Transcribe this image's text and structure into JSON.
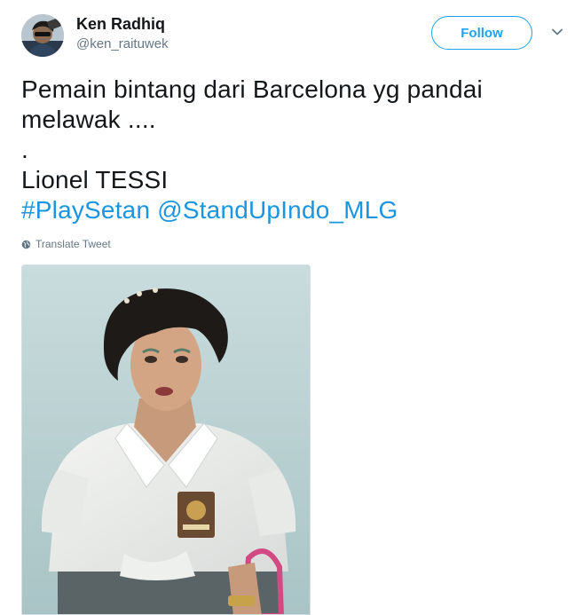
{
  "user": {
    "display_name": "Ken Radhiq",
    "handle": "@ken_raituwek"
  },
  "actions": {
    "follow_label": "Follow"
  },
  "tweet": {
    "line1": "Pemain bintang dari Barcelona yg pandai",
    "line2": "melawak ....",
    "line3": ".",
    "line4": "Lionel TESSI",
    "hashtag": "#PlaySetan",
    "mention": "@StandUpIndo_MLG"
  },
  "translate_label": "Translate Tweet",
  "colors": {
    "accent": "#1da1f2",
    "link": "#1b95e0",
    "text": "#14171a",
    "secondary": "#657786"
  },
  "icons": [
    "chevron-down-icon",
    "globe-icon"
  ]
}
